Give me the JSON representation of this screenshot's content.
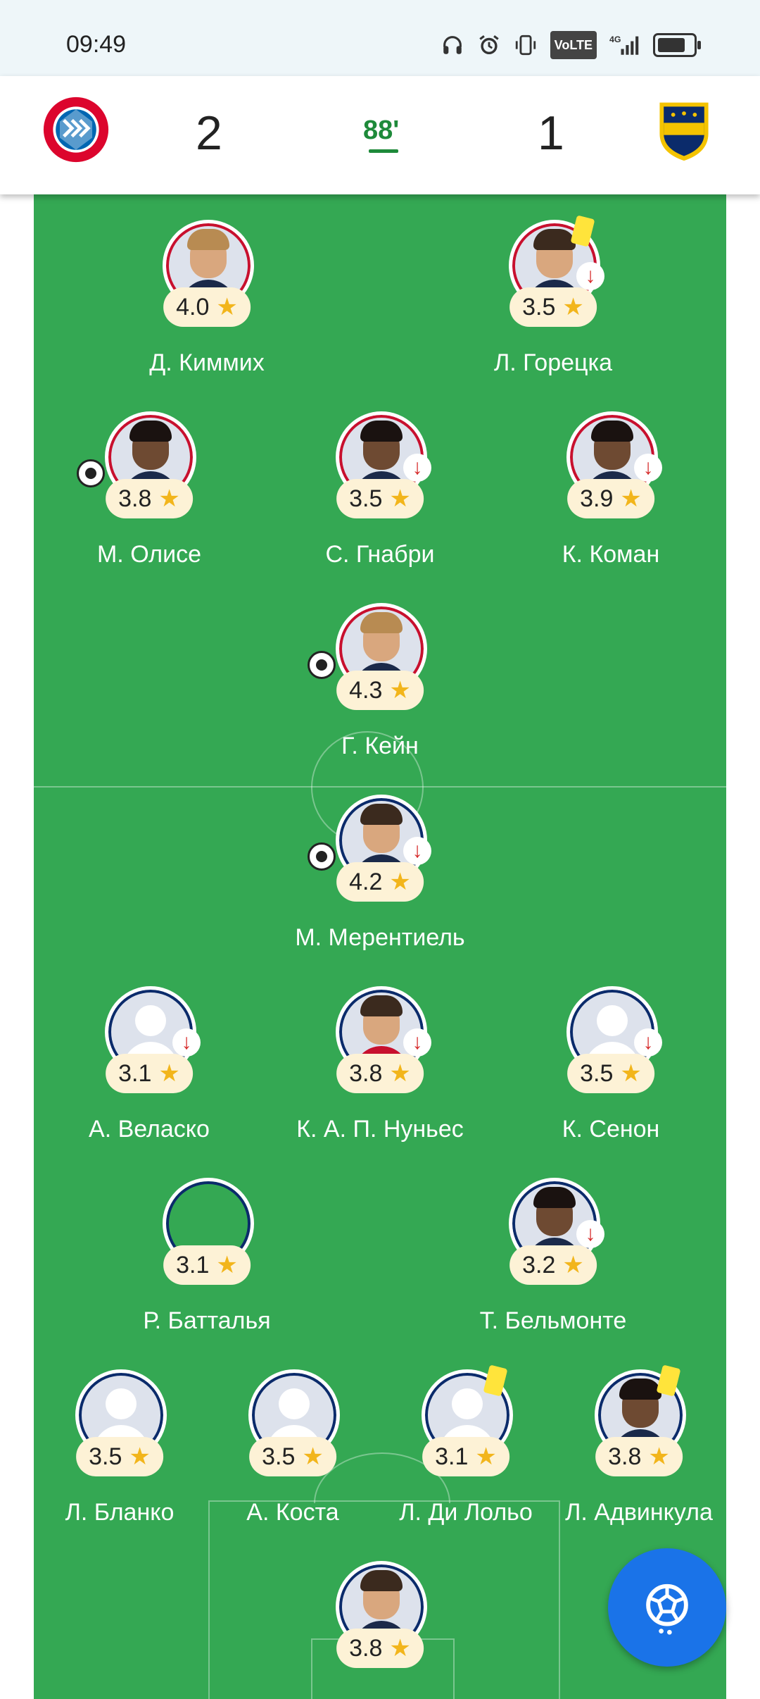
{
  "status_bar": {
    "time": "09:49",
    "icons": [
      "headphones-icon",
      "alarm-icon",
      "vibrate-icon",
      "volte-icon",
      "signal-4g-icon",
      "battery-icon"
    ],
    "volte_label": "VoLTE",
    "network_label": "4G"
  },
  "match": {
    "home": {
      "logo": "fc-bayern-logo",
      "score": "2"
    },
    "away": {
      "logo": "boca-juniors-logo",
      "score": "1"
    },
    "minute": "88'",
    "minute_color": "#1e8a3a"
  },
  "colors": {
    "pitch": "#34a853",
    "home_ring": "#c8102e",
    "away_ring": "#0b2b6b",
    "rating_bg": "#fdf2d6",
    "star": "#f2b51b",
    "fab": "#1a73e8"
  },
  "players": {
    "home": [
      {
        "name": "Д. Киммих",
        "rating": "4.0"
      },
      {
        "name": "Л. Горецка",
        "rating": "3.5"
      },
      {
        "name": "М. Олисе",
        "rating": "3.8"
      },
      {
        "name": "С. Гнабри",
        "rating": "3.5"
      },
      {
        "name": "К. Коман",
        "rating": "3.9"
      },
      {
        "name": "Г. Кейн",
        "rating": "4.3"
      }
    ],
    "away": [
      {
        "name": "М. Мерентиель",
        "rating": "4.2"
      },
      {
        "name": "А. Веласко",
        "rating": "3.1"
      },
      {
        "name": "К. А. П. Нуньес",
        "rating": "3.8"
      },
      {
        "name": "К. Сенон",
        "rating": "3.5"
      },
      {
        "name": "Р. Батталья",
        "rating": "3.1"
      },
      {
        "name": "Т. Бельмонте",
        "rating": "3.2"
      },
      {
        "name": "Л. Бланко",
        "rating": "3.5"
      },
      {
        "name": "А. Коста",
        "rating": "3.5"
      },
      {
        "name": "Л. Ди Лольо",
        "rating": "3.1"
      },
      {
        "name": "Л. Адвинкула",
        "rating": "3.8"
      },
      {
        "name": "",
        "rating": "3.8"
      }
    ]
  },
  "fab": {
    "icon": "football-icon"
  }
}
